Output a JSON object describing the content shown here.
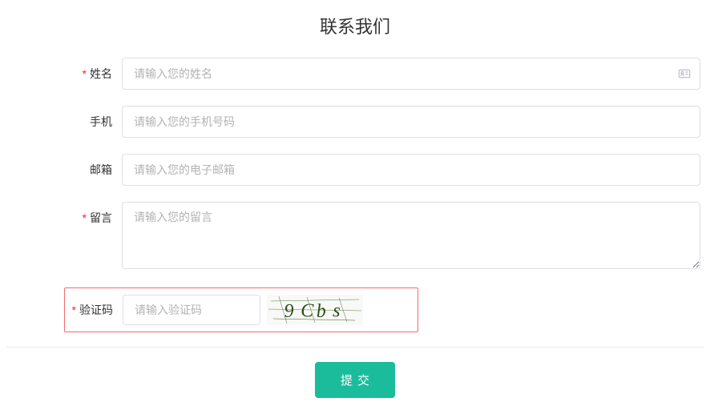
{
  "title": "联系我们",
  "form": {
    "name": {
      "label": "姓名",
      "placeholder": "请输入您的姓名",
      "required": true
    },
    "phone": {
      "label": "手机",
      "placeholder": "请输入您的手机号码",
      "required": false
    },
    "email": {
      "label": "邮箱",
      "placeholder": "请输入您的电子邮箱",
      "required": false
    },
    "message": {
      "label": "留言",
      "placeholder": "请输入您的留言",
      "required": true
    },
    "captcha": {
      "label": "验证码",
      "placeholder": "请输入验证码",
      "required": true,
      "image_text": "9Cbs"
    }
  },
  "submit_label": "提交",
  "required_marker": "*"
}
